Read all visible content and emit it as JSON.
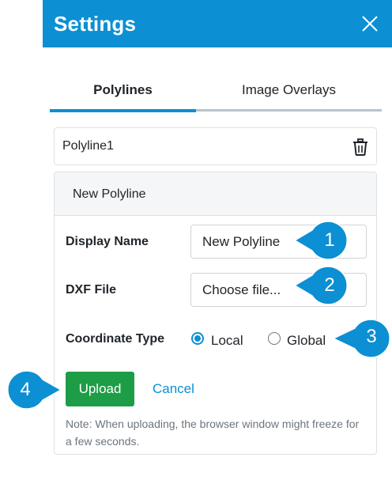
{
  "header": {
    "title": "Settings",
    "close_icon": "close-icon"
  },
  "tabs": [
    {
      "label": "Polylines",
      "active": true
    },
    {
      "label": "Image Overlays",
      "active": false
    }
  ],
  "list": [
    {
      "name": "Polyline1",
      "icon": "trash-icon"
    }
  ],
  "form": {
    "header": "New Polyline",
    "display_name_label": "Display Name",
    "display_name_value": "New Polyline",
    "dxf_label": "DXF File",
    "dxf_value": "Choose file...",
    "coord_label": "Coordinate Type",
    "coord_options": [
      {
        "label": "Local",
        "checked": true
      },
      {
        "label": "Global",
        "checked": false
      }
    ],
    "upload_label": "Upload",
    "cancel_label": "Cancel",
    "note": "Note: When uploading, the browser window might freeze for a few seconds."
  },
  "callouts": [
    "1",
    "2",
    "3",
    "4"
  ],
  "colors": {
    "accent": "#0c8fd3",
    "success": "#1e9d47",
    "callout": "#0c8fd3"
  }
}
